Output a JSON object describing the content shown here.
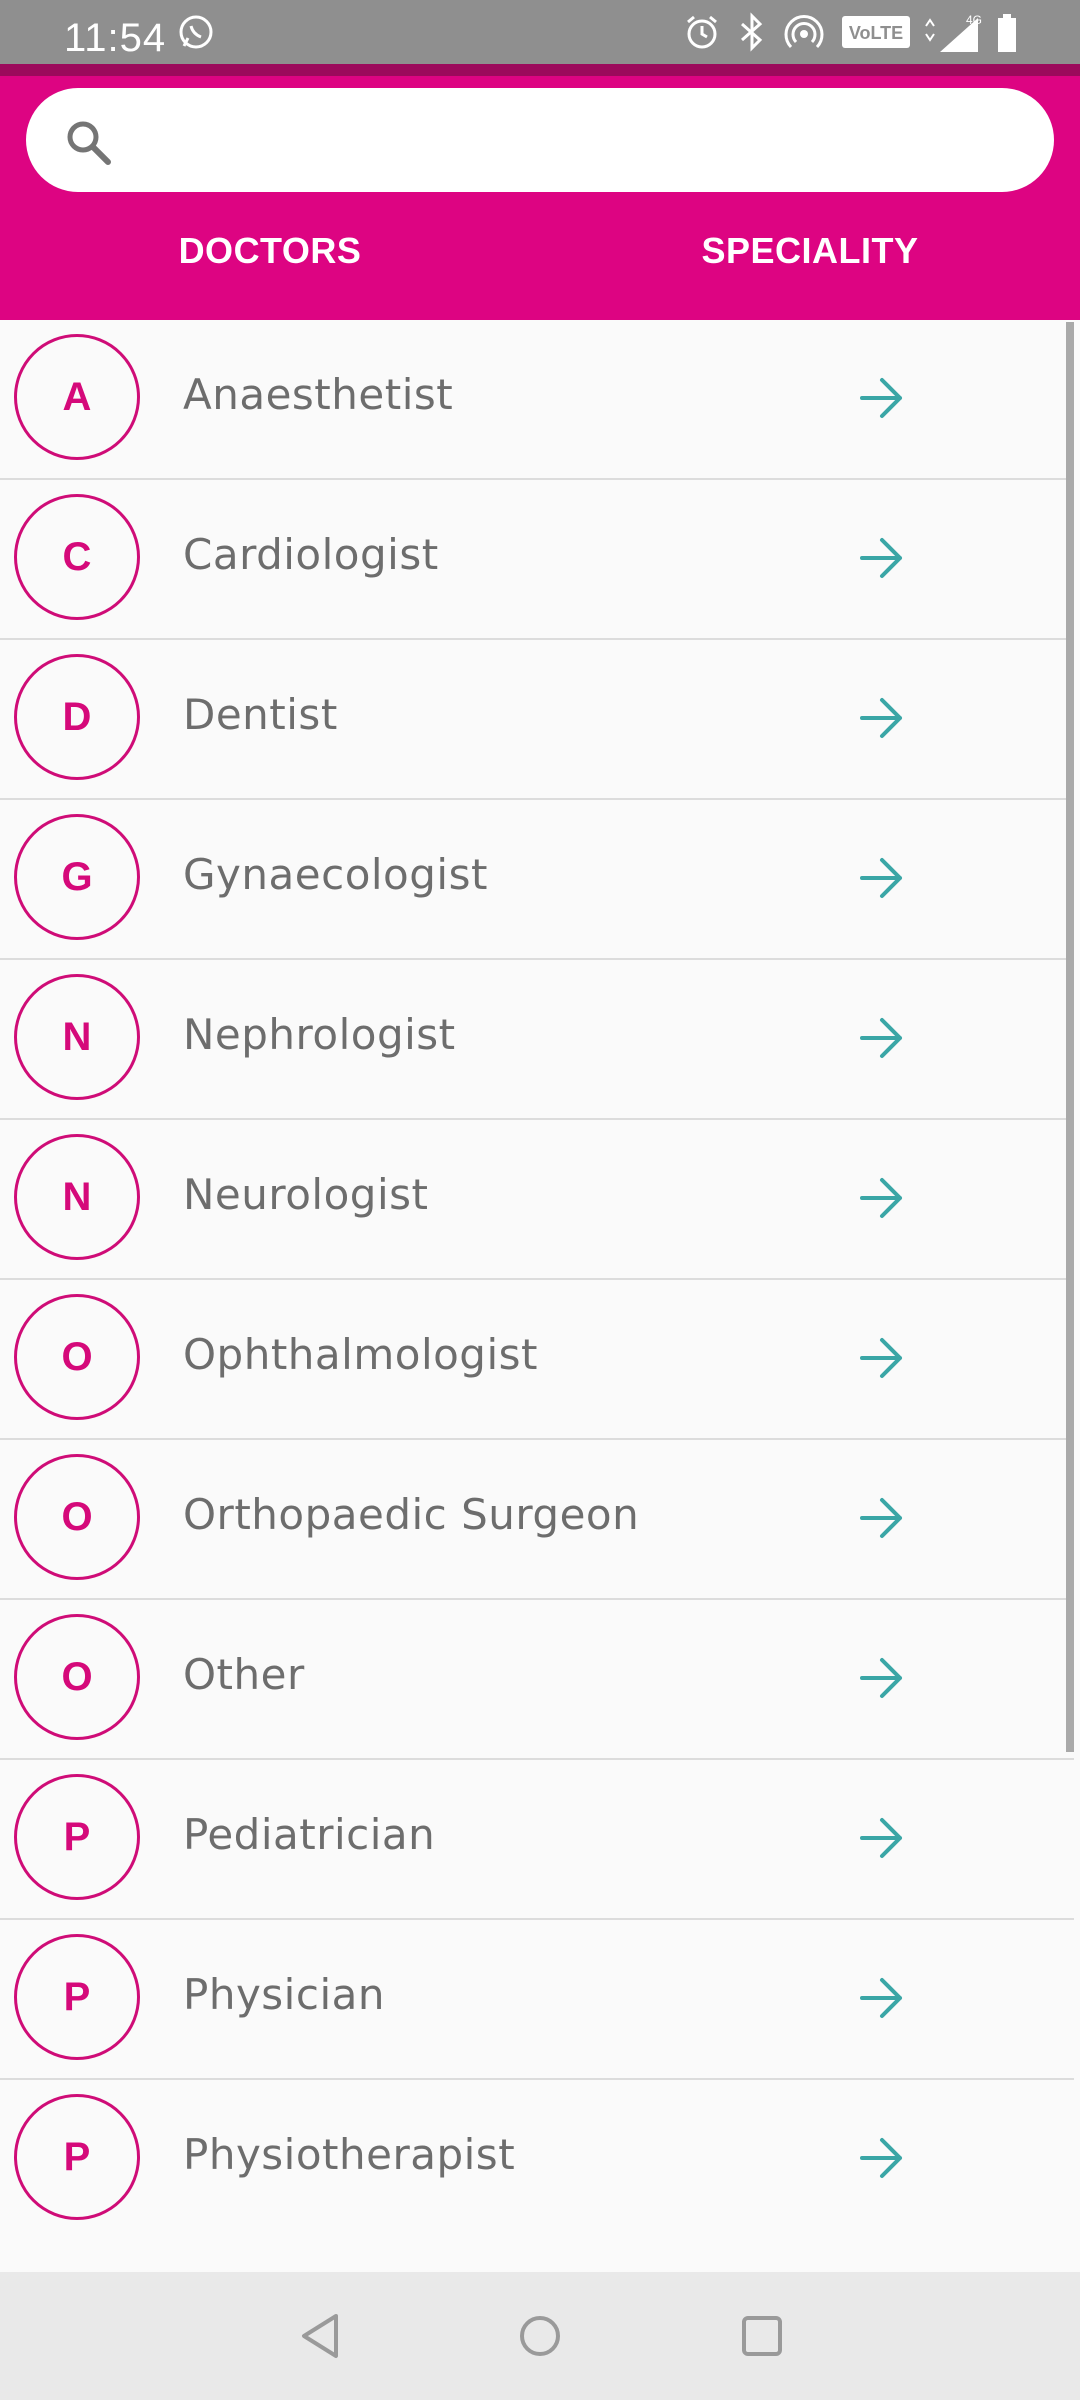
{
  "status_bar": {
    "time": "11:54",
    "icons": [
      "whatsapp-icon",
      "alarm-icon",
      "bluetooth-icon",
      "hotspot-icon",
      "volte-icon",
      "signal-4g-icon",
      "battery-icon"
    ],
    "volte_label": "VoLTE",
    "network_label": "4G"
  },
  "search": {
    "placeholder": "",
    "value": ""
  },
  "tabs": [
    {
      "label": "DOCTORS"
    },
    {
      "label": "SPECIALITY"
    }
  ],
  "specialities": [
    {
      "letter": "A",
      "name": "Anaesthetist"
    },
    {
      "letter": "C",
      "name": "Cardiologist"
    },
    {
      "letter": "D",
      "name": "Dentist"
    },
    {
      "letter": "G",
      "name": "Gynaecologist"
    },
    {
      "letter": "N",
      "name": "Nephrologist"
    },
    {
      "letter": "N",
      "name": "Neurologist"
    },
    {
      "letter": "O",
      "name": "Ophthalmologist"
    },
    {
      "letter": "O",
      "name": "Orthopaedic Surgeon"
    },
    {
      "letter": "O",
      "name": "Other"
    },
    {
      "letter": "P",
      "name": "Pediatrician"
    },
    {
      "letter": "P",
      "name": "Physician"
    },
    {
      "letter": "P",
      "name": "Physiotherapist"
    }
  ],
  "colors": {
    "brand": "#dd0482",
    "avatar_border": "#cf0c77",
    "arrow": "#3aa6a6",
    "text": "#6d6d6d"
  }
}
